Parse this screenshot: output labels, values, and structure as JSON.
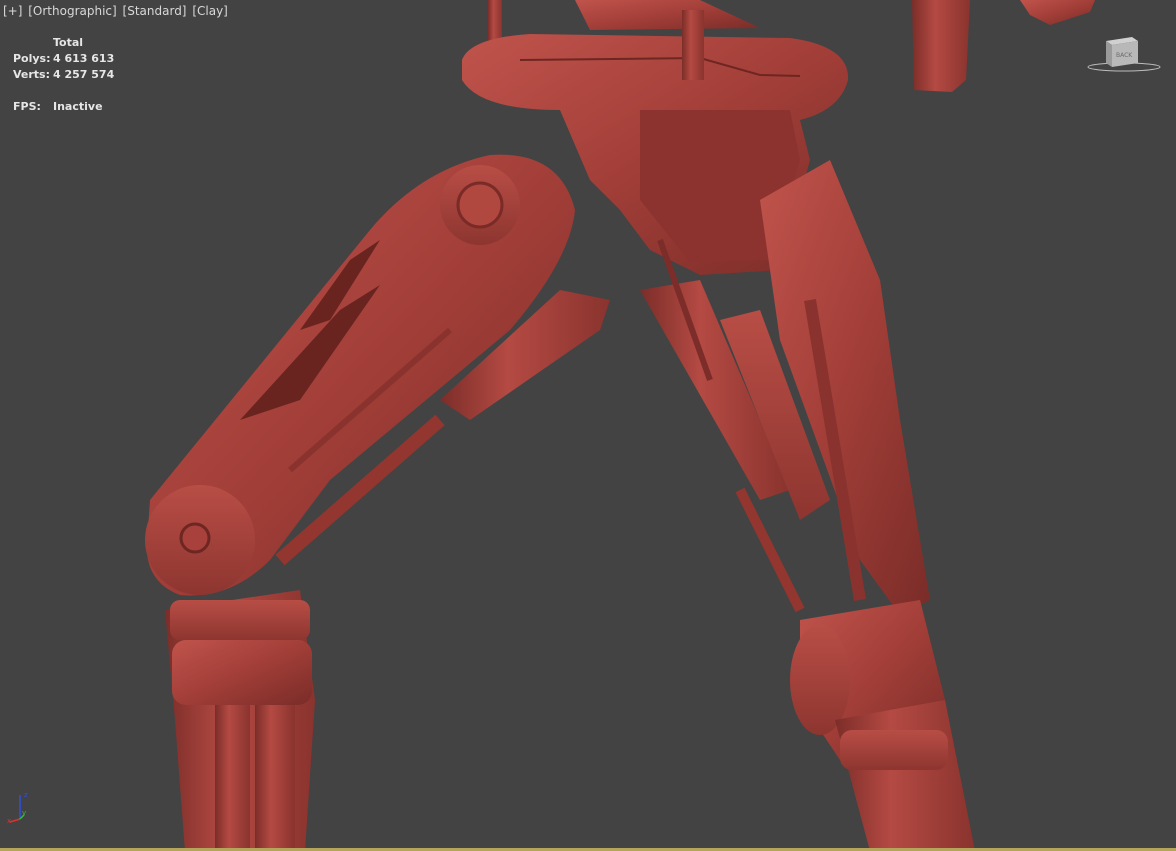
{
  "viewport": {
    "menu": {
      "plus": "[+]",
      "view": "[Orthographic]",
      "shading": "[Standard]",
      "style": "[Clay]"
    },
    "stats": {
      "header": "Total",
      "polys_label": "Polys:",
      "polys_value": "4 613 613",
      "verts_label": "Verts:",
      "verts_value": "4 257 574",
      "fps_label": "FPS:",
      "fps_value": "Inactive"
    },
    "viewcube_face": "BACK",
    "axes": {
      "x": "x",
      "y": "y",
      "z": "z"
    },
    "colors": {
      "background": "#434343",
      "clay": "#a8403b",
      "axis_x": "#e03030",
      "axis_y": "#30c030",
      "axis_z": "#3050e0"
    }
  }
}
